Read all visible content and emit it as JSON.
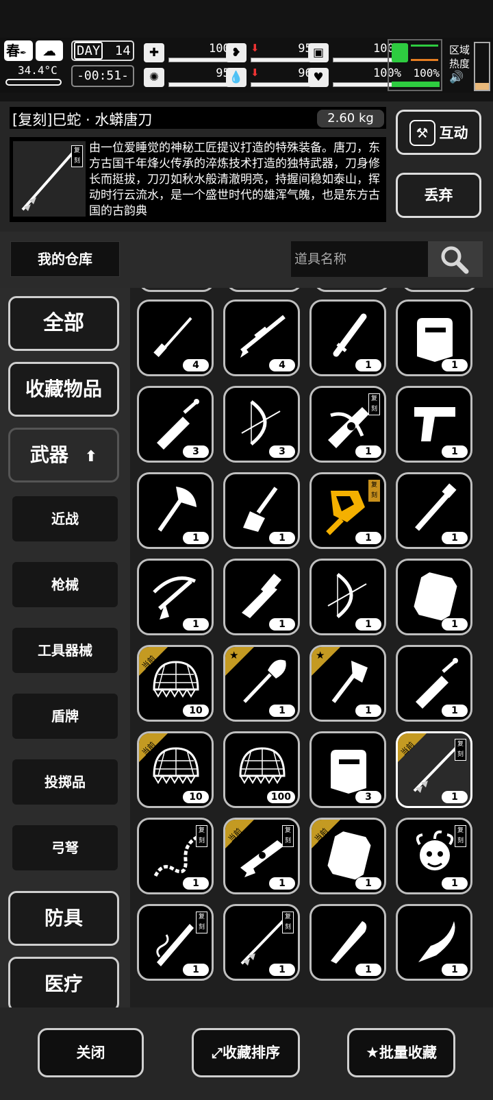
{
  "status": {
    "season": "春",
    "day_label": "DAY",
    "day_number": "14",
    "temperature": "34.4°C",
    "clock": "-00:51-",
    "stats": [
      {
        "icon": "medkit-icon",
        "value": "100%",
        "level": 1.0,
        "down": false
      },
      {
        "icon": "stomach-icon",
        "value": "95%",
        "level": 0.95,
        "down": true
      },
      {
        "icon": "energy-icon",
        "value": "100%",
        "level": 1.0,
        "down": false
      },
      {
        "icon": "brain-icon",
        "value": "95%",
        "level": 0.95,
        "down": false
      },
      {
        "icon": "water-drop-icon",
        "value": "96%",
        "level": 0.96,
        "down": true
      },
      {
        "icon": "heart-icon",
        "value": "100%",
        "level": 1.0,
        "down": false
      }
    ],
    "stamina_value": "100%",
    "stamina_level": 1.0,
    "zone_heat_label_1": "区域",
    "zone_heat_label_2": "热度"
  },
  "item": {
    "name": "[复刻]巳蛇 · 水蟒唐刀",
    "weight": "2.60 kg",
    "copy_tag": "复刻",
    "description": "由一位爱睡觉的神秘工匠提议打造的特殊装备。唐刀，东方古国千年烽火传承的淬炼技术打造的独特武器，刀身修长而挺拔，刀刃如秋水般清澈明亮，持握间稳如泰山，挥动时行云流水，是一个盛世时代的雄浑气魄，也是东方古国的古韵典",
    "interact_label": "互动",
    "discard_label": "丢弃"
  },
  "warehouse": {
    "label": "我的仓库",
    "search_placeholder": "道具名称"
  },
  "sidebar": {
    "all": "全部",
    "favorites": "收藏物品",
    "weapons": "武器",
    "subs": [
      "近战",
      "枪械",
      "工具器械",
      "盾牌",
      "投掷品",
      "弓弩"
    ],
    "armor": "防具",
    "medical": "医疗"
  },
  "ribbon_labels": {
    "equipped": "当前"
  },
  "items": [
    {
      "icon": "screwdriver-icon",
      "count": "4"
    },
    {
      "icon": "sniper-rifle-icon",
      "count": "4"
    },
    {
      "icon": "baton-icon",
      "count": "1"
    },
    {
      "icon": "riot-shield-icon",
      "count": "1"
    },
    {
      "icon": "broadsword-icon",
      "count": "3"
    },
    {
      "icon": "compound-bow-icon",
      "count": "3"
    },
    {
      "icon": "ornate-crossbow-icon",
      "count": "1",
      "copy": "复刻"
    },
    {
      "icon": "desert-eagle-icon",
      "count": "1"
    },
    {
      "icon": "axe-icon",
      "count": "1"
    },
    {
      "icon": "scraper-icon",
      "count": "1"
    },
    {
      "icon": "golden-gauntlet-icon",
      "count": "1",
      "copy": "复刻",
      "gold": true,
      "highlight": true
    },
    {
      "icon": "pipe-icon",
      "count": "1"
    },
    {
      "icon": "pistol-crossbow-icon",
      "count": "1"
    },
    {
      "icon": "caliper-knife-icon",
      "count": "1"
    },
    {
      "icon": "compound-bow-icon",
      "count": "1"
    },
    {
      "icon": "armored-shield-icon",
      "count": "1"
    },
    {
      "icon": "net-icon",
      "count": "10",
      "ribbon": "equipped"
    },
    {
      "icon": "shovel-icon",
      "count": "1",
      "ribbon": "star"
    },
    {
      "icon": "hatchet-icon",
      "count": "1",
      "ribbon": "star"
    },
    {
      "icon": "broadsword-icon",
      "count": "1"
    },
    {
      "icon": "net-icon",
      "count": "10",
      "ribbon": "equipped"
    },
    {
      "icon": "net-icon",
      "count": "100"
    },
    {
      "icon": "riot-shield-icon",
      "count": "3"
    },
    {
      "icon": "tang-saber-icon",
      "count": "1",
      "copy": "复刻",
      "ribbon": "equipped",
      "selected": true
    },
    {
      "icon": "serpent-whip-icon",
      "count": "1",
      "copy": "复刻"
    },
    {
      "icon": "ornate-gun-icon",
      "count": "1",
      "copy": "复刻",
      "ribbon": "equipped"
    },
    {
      "icon": "armored-shield-icon",
      "count": "1",
      "ribbon": "equipped"
    },
    {
      "icon": "medusa-mask-icon",
      "count": "1",
      "copy": "复刻"
    },
    {
      "icon": "serpent-blade-icon",
      "count": "1",
      "copy": "复刻"
    },
    {
      "icon": "tang-saber-icon",
      "count": "1",
      "copy": "复刻"
    },
    {
      "icon": "machete-icon",
      "count": "1"
    },
    {
      "icon": "kukri-icon",
      "count": "1"
    }
  ],
  "bottom": {
    "close": "关闭",
    "sort": "收藏排序",
    "batch": "批量收藏"
  }
}
